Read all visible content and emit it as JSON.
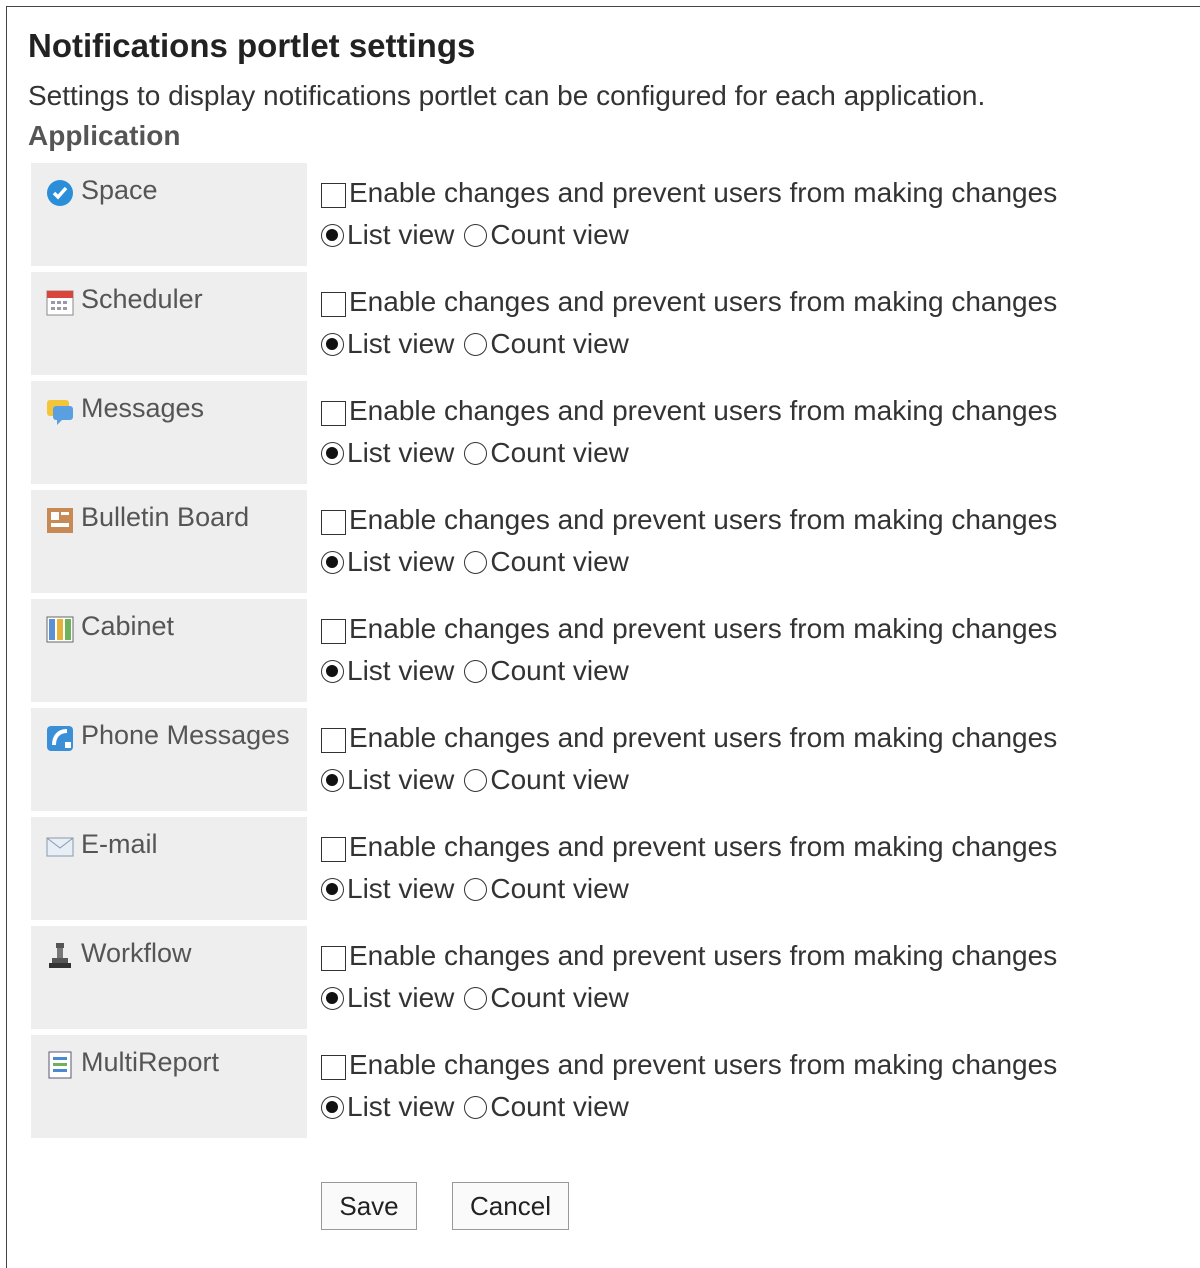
{
  "page": {
    "title": "Notifications portlet settings",
    "description": "Settings to display notifications portlet can be configured for each application.",
    "section_label": "Application"
  },
  "options": {
    "checkbox_label": "Enable changes and prevent users from making changes",
    "list_view_label": "List view",
    "count_view_label": "Count view"
  },
  "applications": [
    {
      "name": "Space",
      "icon": "space-icon",
      "enable_checked": false,
      "view": "list"
    },
    {
      "name": "Scheduler",
      "icon": "scheduler-icon",
      "enable_checked": false,
      "view": "list"
    },
    {
      "name": "Messages",
      "icon": "messages-icon",
      "enable_checked": false,
      "view": "list"
    },
    {
      "name": "Bulletin Board",
      "icon": "bulletin-board-icon",
      "enable_checked": false,
      "view": "list"
    },
    {
      "name": "Cabinet",
      "icon": "cabinet-icon",
      "enable_checked": false,
      "view": "list"
    },
    {
      "name": "Phone Messages",
      "icon": "phone-messages-icon",
      "enable_checked": false,
      "view": "list"
    },
    {
      "name": "E-mail",
      "icon": "email-icon",
      "enable_checked": false,
      "view": "list"
    },
    {
      "name": "Workflow",
      "icon": "workflow-icon",
      "enable_checked": false,
      "view": "list"
    },
    {
      "name": "MultiReport",
      "icon": "multireport-icon",
      "enable_checked": false,
      "view": "list"
    }
  ],
  "buttons": {
    "save_label": "Save",
    "cancel_label": "Cancel"
  }
}
